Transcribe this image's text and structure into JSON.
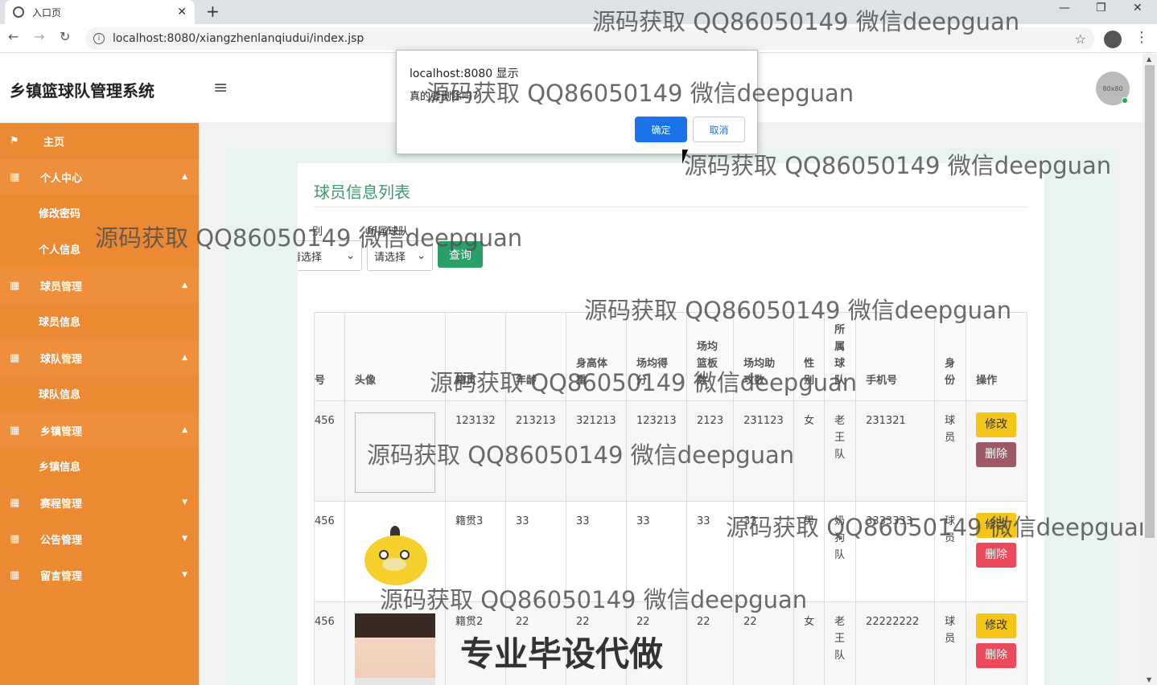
{
  "browser": {
    "tab_title": "入口页",
    "url": "localhost:8080/xiangzhenlanqiudui/index.jsp",
    "new_tab": "+",
    "close_tab": "✕"
  },
  "header": {
    "app_title": "乡镇篮球队管理系统",
    "avatar_text": "80x80"
  },
  "sidebar": {
    "items": [
      {
        "label": "主页",
        "type": "home"
      },
      {
        "label": "个人中心",
        "type": "parent",
        "expanded": true
      },
      {
        "label": "修改密码",
        "type": "child"
      },
      {
        "label": "个人信息",
        "type": "child"
      },
      {
        "label": "球员管理",
        "type": "parent",
        "expanded": true
      },
      {
        "label": "球员信息",
        "type": "child"
      },
      {
        "label": "球队管理",
        "type": "parent",
        "expanded": true
      },
      {
        "label": "球队信息",
        "type": "child"
      },
      {
        "label": "乡镇管理",
        "type": "parent",
        "expanded": true
      },
      {
        "label": "乡镇信息",
        "type": "child"
      },
      {
        "label": "赛程管理",
        "type": "parent",
        "expanded": false
      },
      {
        "label": "公告管理",
        "type": "parent",
        "expanded": false
      },
      {
        "label": "留言管理",
        "type": "parent",
        "expanded": false
      }
    ]
  },
  "main": {
    "card_title": "球员信息列表",
    "filters": {
      "label1": "别",
      "label2": "所属球队",
      "select1": "请选择",
      "select2": "请选择",
      "search_label": "查询"
    },
    "table": {
      "headers": [
        "号",
        "头像",
        "籍贯",
        "年龄",
        "身高体重",
        "场均得分",
        "场均篮板数",
        "场均助攻数",
        "性别",
        "所属球队",
        "手机号",
        "身份",
        "操作"
      ],
      "rows": [
        {
          "no": "456",
          "photo": "broken",
          "origin": "123132",
          "age": "213213",
          "height": "321213",
          "points": "123213",
          "rebounds": "2123",
          "assists": "231123",
          "gender": "女",
          "team": "老王队",
          "phone": "231321",
          "role": "球员"
        },
        {
          "no": "456",
          "photo": "duck",
          "origin": "籍贯3",
          "age": "33",
          "height": "33",
          "points": "33",
          "rebounds": "33",
          "assists": "33",
          "gender": "男",
          "team": "奶狗队",
          "phone": "3333333",
          "role": "球员"
        },
        {
          "no": "456",
          "photo": "face",
          "origin": "籍贯2",
          "age": "22",
          "height": "22",
          "points": "22",
          "rebounds": "22",
          "assists": "22",
          "gender": "女",
          "team": "老王队",
          "phone": "22222222",
          "role": "球员"
        }
      ],
      "edit_label": "修改",
      "delete_label": "删除"
    }
  },
  "dialog": {
    "title": "localhost:8080 显示",
    "message": "真的要删除吗?",
    "ok_label": "确定",
    "cancel_label": "取消"
  },
  "watermarks": {
    "text": "源码获取 QQ86050149 微信deepguan",
    "big_text": "专业毕设代做"
  },
  "colors": {
    "sidebar": "#ec8a33",
    "accent_green": "#28a068",
    "title_green": "#3c9a6c",
    "edit_yellow": "#f5c518",
    "delete_red": "#ea4a5a",
    "dialog_blue": "#1a73e8"
  }
}
